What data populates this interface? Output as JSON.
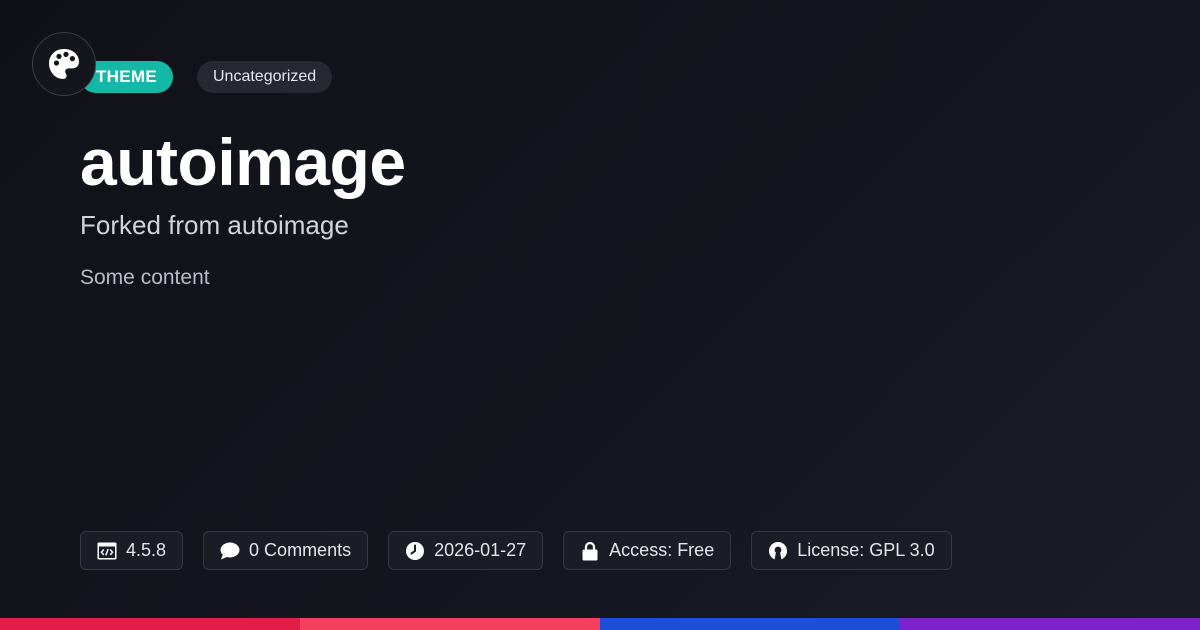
{
  "header": {
    "type_badge": "THEME",
    "category_badge": "Uncategorized"
  },
  "main": {
    "title": "autoimage",
    "subtitle": "Forked from autoimage",
    "content": "Some content"
  },
  "meta": {
    "version": "4.5.8",
    "comments": "0 Comments",
    "date": "2026-01-27",
    "access": "Access: Free",
    "license": "License: GPL 3.0"
  },
  "icons": {
    "logo": "palette-icon",
    "version": "code-window-icon",
    "comments": "speech-bubble-icon",
    "date": "clock-icon",
    "access": "lock-icon",
    "license": "open-source-icon"
  },
  "colors": {
    "accent": "#14b8a6",
    "stripe": [
      "#e11d48",
      "#f43f5e",
      "#1d4ed8",
      "#7e22ce"
    ]
  }
}
